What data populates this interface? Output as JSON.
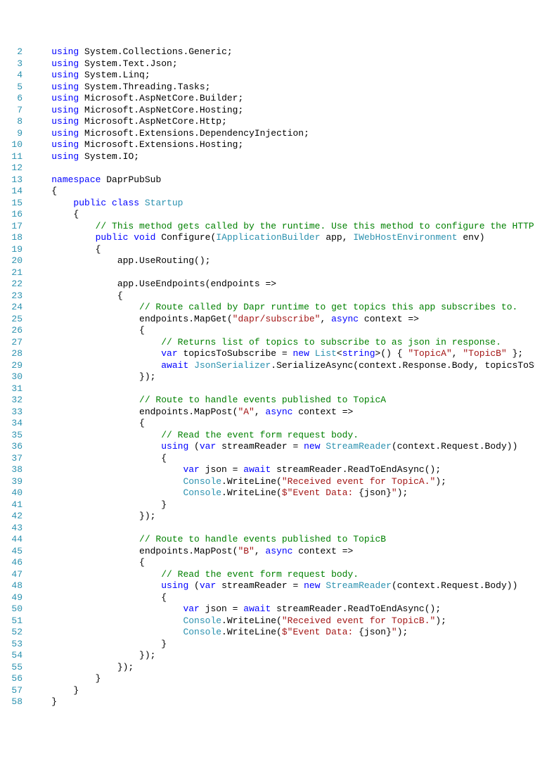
{
  "lines": [
    {
      "n": 2,
      "segments": [
        {
          "t": "    "
        },
        {
          "t": "using",
          "c": "kw"
        },
        {
          "t": " System.Collections.Generic;"
        }
      ]
    },
    {
      "n": 3,
      "segments": [
        {
          "t": "    "
        },
        {
          "t": "using",
          "c": "kw"
        },
        {
          "t": " System.Text.Json;"
        }
      ]
    },
    {
      "n": 4,
      "segments": [
        {
          "t": "    "
        },
        {
          "t": "using",
          "c": "kw"
        },
        {
          "t": " System.Linq;"
        }
      ]
    },
    {
      "n": 5,
      "segments": [
        {
          "t": "    "
        },
        {
          "t": "using",
          "c": "kw"
        },
        {
          "t": " System.Threading.Tasks;"
        }
      ]
    },
    {
      "n": 6,
      "segments": [
        {
          "t": "    "
        },
        {
          "t": "using",
          "c": "kw"
        },
        {
          "t": " Microsoft.AspNetCore.Builder;"
        }
      ]
    },
    {
      "n": 7,
      "segments": [
        {
          "t": "    "
        },
        {
          "t": "using",
          "c": "kw"
        },
        {
          "t": " Microsoft.AspNetCore.Hosting;"
        }
      ]
    },
    {
      "n": 8,
      "segments": [
        {
          "t": "    "
        },
        {
          "t": "using",
          "c": "kw"
        },
        {
          "t": " Microsoft.AspNetCore.Http;"
        }
      ]
    },
    {
      "n": 9,
      "segments": [
        {
          "t": "    "
        },
        {
          "t": "using",
          "c": "kw"
        },
        {
          "t": " Microsoft.Extensions.DependencyInjection;"
        }
      ]
    },
    {
      "n": 10,
      "segments": [
        {
          "t": "    "
        },
        {
          "t": "using",
          "c": "kw"
        },
        {
          "t": " Microsoft.Extensions.Hosting;"
        }
      ]
    },
    {
      "n": 11,
      "segments": [
        {
          "t": "    "
        },
        {
          "t": "using",
          "c": "kw"
        },
        {
          "t": " System.IO;"
        }
      ]
    },
    {
      "n": 12,
      "segments": []
    },
    {
      "n": 13,
      "segments": [
        {
          "t": "    "
        },
        {
          "t": "namespace",
          "c": "kw"
        },
        {
          "t": " DaprPubSub"
        }
      ]
    },
    {
      "n": 14,
      "segments": [
        {
          "t": "    {"
        }
      ]
    },
    {
      "n": 15,
      "segments": [
        {
          "t": "        "
        },
        {
          "t": "public",
          "c": "kw"
        },
        {
          "t": " "
        },
        {
          "t": "class",
          "c": "kw"
        },
        {
          "t": " "
        },
        {
          "t": "Startup",
          "c": "type"
        }
      ]
    },
    {
      "n": 16,
      "segments": [
        {
          "t": "        {"
        }
      ]
    },
    {
      "n": 17,
      "segments": [
        {
          "t": "            "
        },
        {
          "t": "// This method gets called by the runtime. Use this method to configure the HTTP request pipeline.",
          "c": "com"
        }
      ]
    },
    {
      "n": 18,
      "segments": [
        {
          "t": "            "
        },
        {
          "t": "public",
          "c": "kw"
        },
        {
          "t": " "
        },
        {
          "t": "void",
          "c": "kw"
        },
        {
          "t": " Configure("
        },
        {
          "t": "IApplicationBuilder",
          "c": "type"
        },
        {
          "t": " app, "
        },
        {
          "t": "IWebHostEnvironment",
          "c": "type"
        },
        {
          "t": " env)"
        }
      ]
    },
    {
      "n": 19,
      "segments": [
        {
          "t": "            {"
        }
      ]
    },
    {
      "n": 20,
      "segments": [
        {
          "t": "                app.UseRouting();"
        }
      ]
    },
    {
      "n": 21,
      "segments": []
    },
    {
      "n": 22,
      "segments": [
        {
          "t": "                app.UseEndpoints(endpoints =>"
        }
      ]
    },
    {
      "n": 23,
      "segments": [
        {
          "t": "                {"
        }
      ]
    },
    {
      "n": 24,
      "segments": [
        {
          "t": "                    "
        },
        {
          "t": "// Route called by Dapr runtime to get topics this app subscribes to.",
          "c": "com"
        }
      ]
    },
    {
      "n": 25,
      "segments": [
        {
          "t": "                    endpoints.MapGet("
        },
        {
          "t": "\"dapr/subscribe\"",
          "c": "str"
        },
        {
          "t": ", "
        },
        {
          "t": "async",
          "c": "kw"
        },
        {
          "t": " context =>"
        }
      ]
    },
    {
      "n": 26,
      "segments": [
        {
          "t": "                    {"
        }
      ]
    },
    {
      "n": 27,
      "segments": [
        {
          "t": "                        "
        },
        {
          "t": "// Returns list of topics to subscribe to as json in response.",
          "c": "com"
        }
      ]
    },
    {
      "n": 28,
      "segments": [
        {
          "t": "                        "
        },
        {
          "t": "var",
          "c": "kw"
        },
        {
          "t": " topicsToSubscribe = "
        },
        {
          "t": "new",
          "c": "kw"
        },
        {
          "t": " "
        },
        {
          "t": "List",
          "c": "type"
        },
        {
          "t": "<"
        },
        {
          "t": "string",
          "c": "kw"
        },
        {
          "t": ">() { "
        },
        {
          "t": "\"TopicA\"",
          "c": "str"
        },
        {
          "t": ", "
        },
        {
          "t": "\"TopicB\"",
          "c": "str"
        },
        {
          "t": " };"
        }
      ]
    },
    {
      "n": 29,
      "segments": [
        {
          "t": "                        "
        },
        {
          "t": "await",
          "c": "kw"
        },
        {
          "t": " "
        },
        {
          "t": "JsonSerializer",
          "c": "type"
        },
        {
          "t": ".SerializeAsync(context.Response.Body, topicsToSubscribe);"
        }
      ]
    },
    {
      "n": 30,
      "segments": [
        {
          "t": "                    });"
        }
      ]
    },
    {
      "n": 31,
      "segments": []
    },
    {
      "n": 32,
      "segments": [
        {
          "t": "                    "
        },
        {
          "t": "// Route to handle events published to TopicA",
          "c": "com"
        }
      ]
    },
    {
      "n": 33,
      "segments": [
        {
          "t": "                    endpoints.MapPost("
        },
        {
          "t": "\"A\"",
          "c": "str"
        },
        {
          "t": ", "
        },
        {
          "t": "async",
          "c": "kw"
        },
        {
          "t": " context =>"
        }
      ]
    },
    {
      "n": 34,
      "segments": [
        {
          "t": "                    {"
        }
      ]
    },
    {
      "n": 35,
      "segments": [
        {
          "t": "                        "
        },
        {
          "t": "// Read the event form request body.",
          "c": "com"
        }
      ]
    },
    {
      "n": 36,
      "segments": [
        {
          "t": "                        "
        },
        {
          "t": "using",
          "c": "kw"
        },
        {
          "t": " ("
        },
        {
          "t": "var",
          "c": "kw"
        },
        {
          "t": " streamReader = "
        },
        {
          "t": "new",
          "c": "kw"
        },
        {
          "t": " "
        },
        {
          "t": "StreamReader",
          "c": "type"
        },
        {
          "t": "(context.Request.Body))"
        }
      ]
    },
    {
      "n": 37,
      "segments": [
        {
          "t": "                        {"
        }
      ]
    },
    {
      "n": 38,
      "segments": [
        {
          "t": "                            "
        },
        {
          "t": "var",
          "c": "kw"
        },
        {
          "t": " json = "
        },
        {
          "t": "await",
          "c": "kw"
        },
        {
          "t": " streamReader.ReadToEndAsync();"
        }
      ]
    },
    {
      "n": 39,
      "segments": [
        {
          "t": "                            "
        },
        {
          "t": "Console",
          "c": "type"
        },
        {
          "t": ".WriteLine("
        },
        {
          "t": "\"Received event for TopicA.\"",
          "c": "str"
        },
        {
          "t": ");"
        }
      ]
    },
    {
      "n": 40,
      "segments": [
        {
          "t": "                            "
        },
        {
          "t": "Console",
          "c": "type"
        },
        {
          "t": ".WriteLine("
        },
        {
          "t": "$\"Event Data: ",
          "c": "str"
        },
        {
          "t": "{json}"
        },
        {
          "t": "\"",
          "c": "str"
        },
        {
          "t": ");"
        }
      ]
    },
    {
      "n": 41,
      "segments": [
        {
          "t": "                        }"
        }
      ]
    },
    {
      "n": 42,
      "segments": [
        {
          "t": "                    });"
        }
      ]
    },
    {
      "n": 43,
      "segments": []
    },
    {
      "n": 44,
      "segments": [
        {
          "t": "                    "
        },
        {
          "t": "// Route to handle events published to TopicB",
          "c": "com"
        }
      ]
    },
    {
      "n": 45,
      "segments": [
        {
          "t": "                    endpoints.MapPost("
        },
        {
          "t": "\"B\"",
          "c": "str"
        },
        {
          "t": ", "
        },
        {
          "t": "async",
          "c": "kw"
        },
        {
          "t": " context =>"
        }
      ]
    },
    {
      "n": 46,
      "segments": [
        {
          "t": "                    {"
        }
      ]
    },
    {
      "n": 47,
      "segments": [
        {
          "t": "                        "
        },
        {
          "t": "// Read the event form request body.",
          "c": "com"
        }
      ]
    },
    {
      "n": 48,
      "segments": [
        {
          "t": "                        "
        },
        {
          "t": "using",
          "c": "kw"
        },
        {
          "t": " ("
        },
        {
          "t": "var",
          "c": "kw"
        },
        {
          "t": " streamReader = "
        },
        {
          "t": "new",
          "c": "kw"
        },
        {
          "t": " "
        },
        {
          "t": "StreamReader",
          "c": "type"
        },
        {
          "t": "(context.Request.Body))"
        }
      ]
    },
    {
      "n": 49,
      "segments": [
        {
          "t": "                        {"
        }
      ]
    },
    {
      "n": 50,
      "segments": [
        {
          "t": "                            "
        },
        {
          "t": "var",
          "c": "kw"
        },
        {
          "t": " json = "
        },
        {
          "t": "await",
          "c": "kw"
        },
        {
          "t": " streamReader.ReadToEndAsync();"
        }
      ]
    },
    {
      "n": 51,
      "segments": [
        {
          "t": "                            "
        },
        {
          "t": "Console",
          "c": "type"
        },
        {
          "t": ".WriteLine("
        },
        {
          "t": "\"Received event for TopicB.\"",
          "c": "str"
        },
        {
          "t": ");"
        }
      ]
    },
    {
      "n": 52,
      "segments": [
        {
          "t": "                            "
        },
        {
          "t": "Console",
          "c": "type"
        },
        {
          "t": ".WriteLine("
        },
        {
          "t": "$\"Event Data: ",
          "c": "str"
        },
        {
          "t": "{json}"
        },
        {
          "t": "\"",
          "c": "str"
        },
        {
          "t": ");"
        }
      ]
    },
    {
      "n": 53,
      "segments": [
        {
          "t": "                        }"
        }
      ]
    },
    {
      "n": 54,
      "segments": [
        {
          "t": "                    });"
        }
      ]
    },
    {
      "n": 55,
      "segments": [
        {
          "t": "                });"
        }
      ]
    },
    {
      "n": 56,
      "segments": [
        {
          "t": "            }"
        }
      ]
    },
    {
      "n": 57,
      "segments": [
        {
          "t": "        }"
        }
      ]
    },
    {
      "n": 58,
      "segments": [
        {
          "t": "    }"
        }
      ]
    }
  ]
}
